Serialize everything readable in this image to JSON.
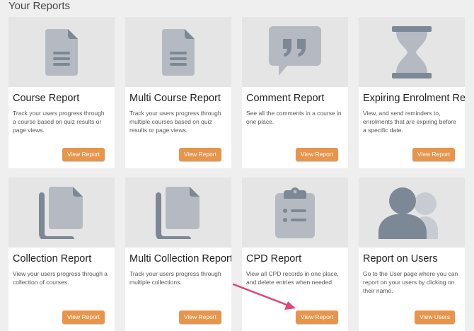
{
  "header": {
    "title": "Your Reports"
  },
  "cards": [
    {
      "title": "Course Report",
      "desc": "Track your users progress through a course based on quiz results or page views.",
      "button": "View Report",
      "icon": "document-icon"
    },
    {
      "title": "Multi Course Report",
      "desc": "Track your users progress through multiple courses based on quiz results or page views.",
      "button": "View Report",
      "icon": "document-icon"
    },
    {
      "title": "Comment Report",
      "desc": "See all the comments in a course in one place.",
      "button": "View Report",
      "icon": "quote-bubble-icon"
    },
    {
      "title": "Expiring Enrolment Re...",
      "desc": "View, and send reminders to, enrolments that are expiring before a specific date.",
      "button": "View Report",
      "icon": "hourglass-icon"
    },
    {
      "title": "Collection Report",
      "desc": "View your users progress through a collection of courses.",
      "button": "View Report",
      "icon": "document-stack-icon"
    },
    {
      "title": "Multi Collection Report",
      "desc": "Track your users progress through multiple collections.",
      "button": "View Report",
      "icon": "document-stack-icon"
    },
    {
      "title": "CPD Report",
      "desc": "View all CPD records in one place, and delete entries when needed.",
      "button": "View Report",
      "icon": "clipboard-icon"
    },
    {
      "title": "Report on Users",
      "desc": "Go to the User page where you can report on your users by clicking on their name.",
      "button": "View Users",
      "icon": "users-icon"
    }
  ],
  "colors": {
    "accent": "#e8954c",
    "icon": "#b5bac2",
    "icon_dark": "#7d8896",
    "annotation": "#e0457b"
  }
}
